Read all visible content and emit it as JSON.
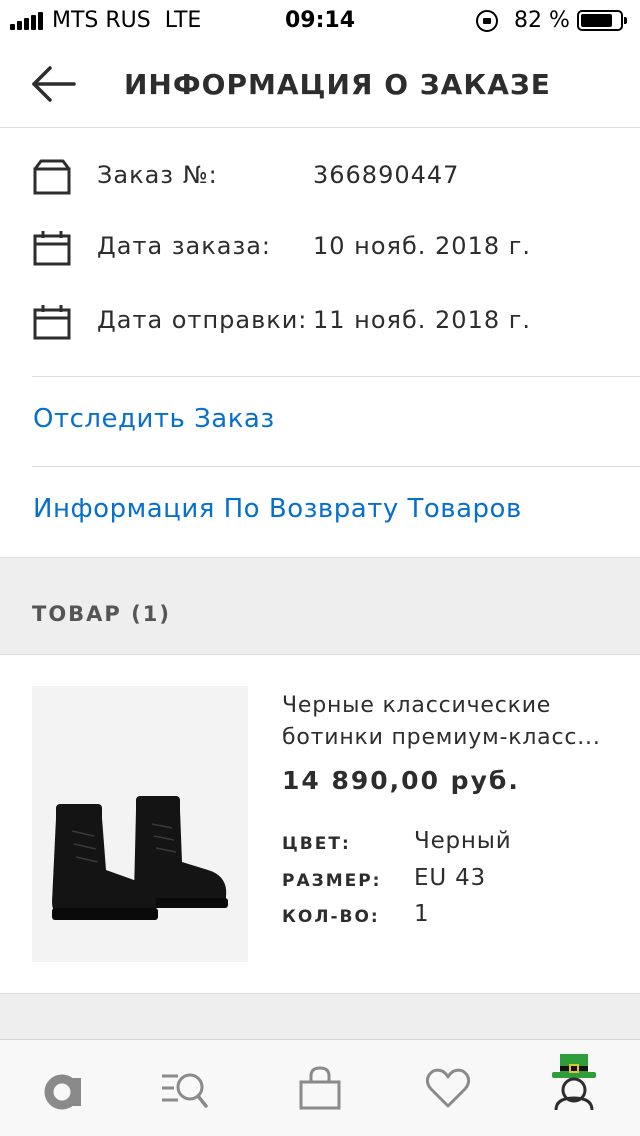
{
  "status_bar": {
    "carrier": "MTS RUS",
    "network": "LTE",
    "time": "09:14",
    "battery_percent": "82 %",
    "battery_level": 0.82
  },
  "header": {
    "back_icon": "arrow-left-icon",
    "title": "ИНФОРМАЦИЯ О ЗАКАЗЕ"
  },
  "order": {
    "number_label": "Заказ №:",
    "number_value": "366890447",
    "order_date_label": "Дата заказа:",
    "order_date_value": "10 нояб. 2018 г.",
    "ship_date_label": "Дата отправки:",
    "ship_date_value": "11 нояб. 2018 г."
  },
  "links": {
    "track": "Отследить Заказ",
    "returns": "Информация По Возврату Товаров"
  },
  "items_section": {
    "title": "ТОВАР (1)"
  },
  "product": {
    "name_line1": "Черные классические",
    "name_line2": "ботинки премиум-класс...",
    "price": "14 890,00 руб.",
    "color_label": "ЦВЕТ:",
    "color_value": "Черный",
    "size_label": "РАЗМЕР:",
    "size_value": "EU 43",
    "qty_label": "КОЛ-ВО:",
    "qty_value": "1",
    "image_icon": "black-boots-image"
  },
  "tab_bar": {
    "items": [
      "home-a-icon",
      "search-icon",
      "bag-icon",
      "heart-icon",
      "profile-icon"
    ]
  },
  "colors": {
    "link": "#0770cf",
    "text": "#2d2d2d",
    "section_bg": "#eeeeee"
  }
}
